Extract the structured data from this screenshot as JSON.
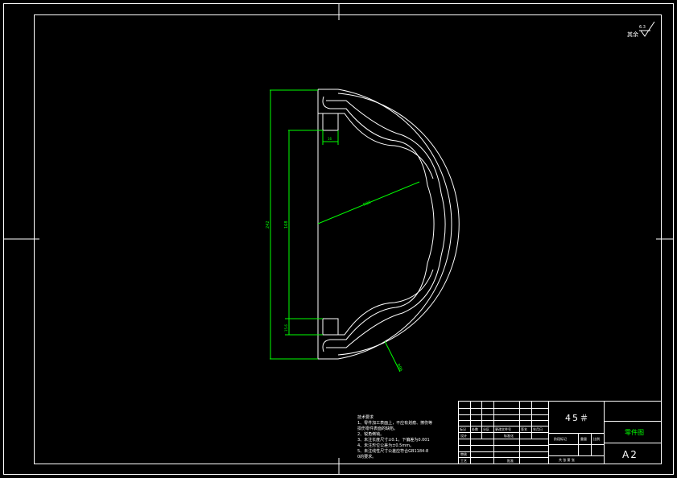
{
  "title_block": {
    "material": "45＃",
    "drawing_name": "零件图",
    "sheet_size": "A2",
    "header_labels": [
      "标记",
      "处数",
      "分区",
      "更改文件号",
      "签名",
      "年月日"
    ],
    "design_label": "设计",
    "standardization_label": "标准化",
    "stage_label": "阶段标记",
    "weight_label": "重量",
    "scale_label": "比例",
    "review_label": "审核",
    "process_label": "工艺",
    "approve_label": "批准",
    "sheets_label": "共  张  第  张"
  },
  "roughness": {
    "label": "其余",
    "value": "6.3"
  },
  "notes": {
    "title": "技术要求",
    "lines": [
      "1、零件加工表面上，不应有划痕、擦伤等",
      "   损伤零件表面的缺陷。",
      "2、锐角倒钝。",
      "3、未注长度尺寸±0.1，下偏差为0.001",
      "4、未注形位公差为±0.5mm。",
      "5、未注线性尺寸公差应符合GB1184-8",
      "   0的要求。"
    ]
  },
  "dimensions": {
    "overall_height": "242",
    "inner_height": "168",
    "slot_width": "16",
    "slot_height": "15.6",
    "inner_radius": "R86",
    "outer_radius": "R96"
  }
}
